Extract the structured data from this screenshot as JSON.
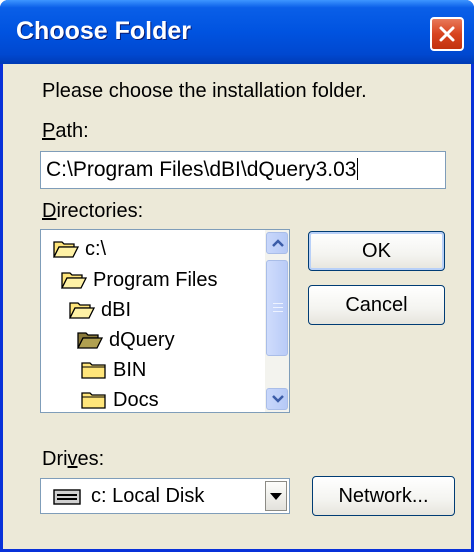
{
  "window": {
    "title": "Choose Folder"
  },
  "prompt": "Please choose the installation folder.",
  "path": {
    "label_mnemonic": "P",
    "label_rest": "ath:",
    "value": "C:\\Program Files\\dBI\\dQuery3.03"
  },
  "directories": {
    "label_mnemonic": "D",
    "label_rest": "irectories:",
    "items": [
      {
        "label": "c:\\",
        "icon": "open-folder-icon"
      },
      {
        "label": "Program Files",
        "icon": "open-folder-icon"
      },
      {
        "label": "dBI",
        "icon": "open-folder-icon"
      },
      {
        "label": "dQuery",
        "icon": "open-folder-selected-icon"
      },
      {
        "label": "BIN",
        "icon": "folder-icon"
      },
      {
        "label": "Docs",
        "icon": "folder-icon"
      }
    ]
  },
  "buttons": {
    "ok": "OK",
    "cancel": "Cancel",
    "network": "Network..."
  },
  "drives": {
    "label_pre": "Dri",
    "label_mnemonic": "v",
    "label_rest": "es:",
    "selected": "c: Local Disk"
  },
  "colors": {
    "titlebar": "#0053e0",
    "close": "#d8441f",
    "folder": "#ffe57a",
    "face": "#ece9d8"
  }
}
